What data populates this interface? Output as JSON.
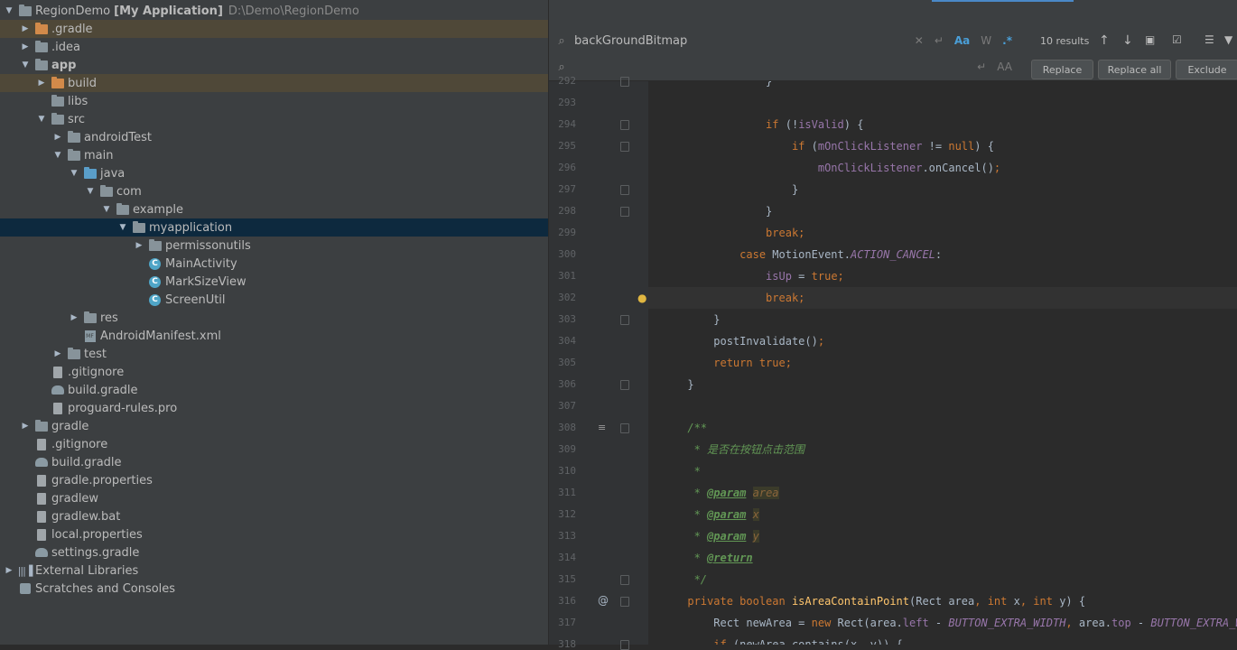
{
  "project_tree": [
    {
      "depth": 0,
      "arrow": "down",
      "icon": "module-folder",
      "label": "RegionDemo",
      "bold_suffix": "[My Application]",
      "path": "D:\\Demo\\RegionDemo",
      "hl": ""
    },
    {
      "depth": 1,
      "arrow": "right",
      "icon": "folder-orange",
      "label": ".gradle",
      "hl": "orange"
    },
    {
      "depth": 1,
      "arrow": "right",
      "icon": "folder",
      "label": ".idea",
      "hl": ""
    },
    {
      "depth": 1,
      "arrow": "down",
      "icon": "module-folder",
      "label": "app",
      "bold": true,
      "hl": ""
    },
    {
      "depth": 2,
      "arrow": "right",
      "icon": "folder-orange",
      "label": "build",
      "hl": "orange"
    },
    {
      "depth": 2,
      "arrow": "",
      "icon": "folder",
      "label": "libs",
      "hl": ""
    },
    {
      "depth": 2,
      "arrow": "down",
      "icon": "folder",
      "label": "src",
      "hl": ""
    },
    {
      "depth": 3,
      "arrow": "right",
      "icon": "folder",
      "label": "androidTest",
      "hl": ""
    },
    {
      "depth": 3,
      "arrow": "down",
      "icon": "folder",
      "label": "main",
      "hl": ""
    },
    {
      "depth": 4,
      "arrow": "down",
      "icon": "folder-blue",
      "label": "java",
      "hl": ""
    },
    {
      "depth": 5,
      "arrow": "down",
      "icon": "package",
      "label": "com",
      "hl": ""
    },
    {
      "depth": 6,
      "arrow": "down",
      "icon": "package",
      "label": "example",
      "hl": ""
    },
    {
      "depth": 7,
      "arrow": "down",
      "icon": "package",
      "label": "myapplication",
      "hl": "blue"
    },
    {
      "depth": 8,
      "arrow": "right",
      "icon": "package",
      "label": "permissonutils",
      "hl": ""
    },
    {
      "depth": 8,
      "arrow": "",
      "icon": "class",
      "label": "MainActivity",
      "hl": ""
    },
    {
      "depth": 8,
      "arrow": "",
      "icon": "class",
      "label": "MarkSizeView",
      "hl": ""
    },
    {
      "depth": 8,
      "arrow": "",
      "icon": "class",
      "label": "ScreenUtil",
      "hl": ""
    },
    {
      "depth": 4,
      "arrow": "right",
      "icon": "res-folder",
      "label": "res",
      "hl": ""
    },
    {
      "depth": 4,
      "arrow": "",
      "icon": "xml",
      "label": "AndroidManifest.xml",
      "hl": ""
    },
    {
      "depth": 3,
      "arrow": "right",
      "icon": "folder",
      "label": "test",
      "hl": ""
    },
    {
      "depth": 2,
      "arrow": "",
      "icon": "file",
      "label": ".gitignore",
      "hl": ""
    },
    {
      "depth": 2,
      "arrow": "",
      "icon": "gradle",
      "label": "build.gradle",
      "hl": ""
    },
    {
      "depth": 2,
      "arrow": "",
      "icon": "file",
      "label": "proguard-rules.pro",
      "hl": ""
    },
    {
      "depth": 1,
      "arrow": "right",
      "icon": "folder",
      "label": "gradle",
      "hl": ""
    },
    {
      "depth": 1,
      "arrow": "",
      "icon": "file",
      "label": ".gitignore",
      "hl": ""
    },
    {
      "depth": 1,
      "arrow": "",
      "icon": "gradle",
      "label": "build.gradle",
      "hl": ""
    },
    {
      "depth": 1,
      "arrow": "",
      "icon": "file",
      "label": "gradle.properties",
      "hl": ""
    },
    {
      "depth": 1,
      "arrow": "",
      "icon": "file",
      "label": "gradlew",
      "hl": ""
    },
    {
      "depth": 1,
      "arrow": "",
      "icon": "file",
      "label": "gradlew.bat",
      "hl": ""
    },
    {
      "depth": 1,
      "arrow": "",
      "icon": "file",
      "label": "local.properties",
      "hl": ""
    },
    {
      "depth": 1,
      "arrow": "",
      "icon": "gradle",
      "label": "settings.gradle",
      "hl": ""
    },
    {
      "depth": 0,
      "arrow": "right",
      "icon": "libraries",
      "label": "External Libraries",
      "hl": ""
    },
    {
      "depth": 0,
      "arrow": "",
      "icon": "scratch",
      "label": "Scratches and Consoles",
      "hl": ""
    }
  ],
  "find": {
    "search_value": "backGroundBitmap",
    "replace_value": "",
    "results": "10 results",
    "match_case_label": "Aa",
    "words_label": "W",
    "regex_label": ".*",
    "replace_btn": "Replace",
    "replace_all_btn": "Replace all",
    "exclude_btn": "Exclude"
  },
  "colors": {
    "keyword": "#cc7832",
    "field": "#9876aa",
    "comment": "#629755",
    "plain": "#a9b7c6",
    "method": "#ffc66d",
    "number": "#6897bb",
    "tag": "#629755"
  },
  "code_lines": [
    {
      "n": "292",
      "segs": [
        [
          "plain",
          "                  }"
        ]
      ]
    },
    {
      "n": "293",
      "segs": []
    },
    {
      "n": "294",
      "segs": [
        [
          "plain",
          "                  "
        ],
        [
          "keyword",
          "if"
        ],
        [
          "plain",
          " (!"
        ],
        [
          "field",
          "isValid"
        ],
        [
          "plain",
          ") {"
        ]
      ]
    },
    {
      "n": "295",
      "segs": [
        [
          "plain",
          "                      "
        ],
        [
          "keyword",
          "if"
        ],
        [
          "plain",
          " ("
        ],
        [
          "field",
          "mOnClickListener"
        ],
        [
          "plain",
          " != "
        ],
        [
          "keyword",
          "null"
        ],
        [
          "plain",
          ") {"
        ]
      ]
    },
    {
      "n": "296",
      "segs": [
        [
          "plain",
          "                          "
        ],
        [
          "field",
          "mOnClickListener"
        ],
        [
          "plain",
          "."
        ],
        [
          "plain",
          "onCancel"
        ],
        [
          "plain",
          "()"
        ],
        [
          "keyword",
          ";"
        ]
      ]
    },
    {
      "n": "297",
      "segs": [
        [
          "plain",
          "                      }"
        ]
      ]
    },
    {
      "n": "298",
      "segs": [
        [
          "plain",
          "                  }"
        ]
      ]
    },
    {
      "n": "299",
      "segs": [
        [
          "plain",
          "                  "
        ],
        [
          "keyword",
          "break;"
        ]
      ]
    },
    {
      "n": "300",
      "segs": [
        [
          "plain",
          "              "
        ],
        [
          "keyword",
          "case"
        ],
        [
          "plain",
          " MotionEvent."
        ],
        [
          "field_italic",
          "ACTION_CANCEL"
        ],
        [
          "plain",
          ":"
        ]
      ]
    },
    {
      "n": "301",
      "segs": [
        [
          "plain",
          "                  "
        ],
        [
          "field",
          "isUp"
        ],
        [
          "plain",
          " = "
        ],
        [
          "keyword",
          "true;"
        ]
      ]
    },
    {
      "n": "302",
      "segs": [
        [
          "plain",
          "                  "
        ],
        [
          "keyword",
          "break;"
        ]
      ],
      "current": true
    },
    {
      "n": "303",
      "segs": [
        [
          "plain",
          "          }"
        ]
      ]
    },
    {
      "n": "304",
      "segs": [
        [
          "plain",
          "          postInvalidate()"
        ],
        [
          "keyword",
          ";"
        ]
      ]
    },
    {
      "n": "305",
      "segs": [
        [
          "plain",
          "          "
        ],
        [
          "keyword",
          "return true;"
        ]
      ]
    },
    {
      "n": "306",
      "segs": [
        [
          "plain",
          "      }"
        ]
      ]
    },
    {
      "n": "307",
      "segs": []
    },
    {
      "n": "308",
      "segs": [
        [
          "comment",
          "      /**"
        ]
      ]
    },
    {
      "n": "309",
      "segs": [
        [
          "comment",
          "       * 是否在按钮点击范围"
        ]
      ]
    },
    {
      "n": "310",
      "segs": [
        [
          "comment",
          "       *"
        ]
      ]
    },
    {
      "n": "311",
      "segs": [
        [
          "comment",
          "       * "
        ],
        [
          "tag",
          "@param"
        ],
        [
          "comment",
          " "
        ],
        [
          "param",
          "area"
        ]
      ]
    },
    {
      "n": "312",
      "segs": [
        [
          "comment",
          "       * "
        ],
        [
          "tag",
          "@param"
        ],
        [
          "comment",
          " "
        ],
        [
          "param",
          "x"
        ]
      ]
    },
    {
      "n": "313",
      "segs": [
        [
          "comment",
          "       * "
        ],
        [
          "tag",
          "@param"
        ],
        [
          "comment",
          " "
        ],
        [
          "param",
          "y"
        ]
      ]
    },
    {
      "n": "314",
      "segs": [
        [
          "comment",
          "       * "
        ],
        [
          "tag",
          "@return"
        ]
      ]
    },
    {
      "n": "315",
      "segs": [
        [
          "comment",
          "       */"
        ]
      ]
    },
    {
      "n": "316",
      "segs": [
        [
          "plain",
          "      "
        ],
        [
          "keyword",
          "private boolean "
        ],
        [
          "method",
          "isAreaContainPoint"
        ],
        [
          "plain",
          "(Rect area"
        ],
        [
          "keyword",
          ", int "
        ],
        [
          "plain",
          "x"
        ],
        [
          "keyword",
          ", int "
        ],
        [
          "plain",
          "y) {"
        ]
      ]
    },
    {
      "n": "317",
      "segs": [
        [
          "plain",
          "          Rect newArea = "
        ],
        [
          "keyword",
          "new "
        ],
        [
          "plain",
          "Rect(area."
        ],
        [
          "field",
          "left"
        ],
        [
          "plain",
          " - "
        ],
        [
          "field_italic",
          "BUTTON_EXTRA_WIDTH"
        ],
        [
          "keyword",
          ", "
        ],
        [
          "plain",
          "area."
        ],
        [
          "field",
          "top"
        ],
        [
          "plain",
          " - "
        ],
        [
          "field_italic",
          "BUTTON_EXTRA_WIDTH"
        ]
      ]
    },
    {
      "n": "318",
      "segs": [
        [
          "plain",
          "          "
        ],
        [
          "keyword",
          "if"
        ],
        [
          "plain",
          " (newArea.contains(x"
        ],
        [
          "keyword",
          ", "
        ],
        [
          "plain",
          "y)) {"
        ]
      ]
    }
  ]
}
